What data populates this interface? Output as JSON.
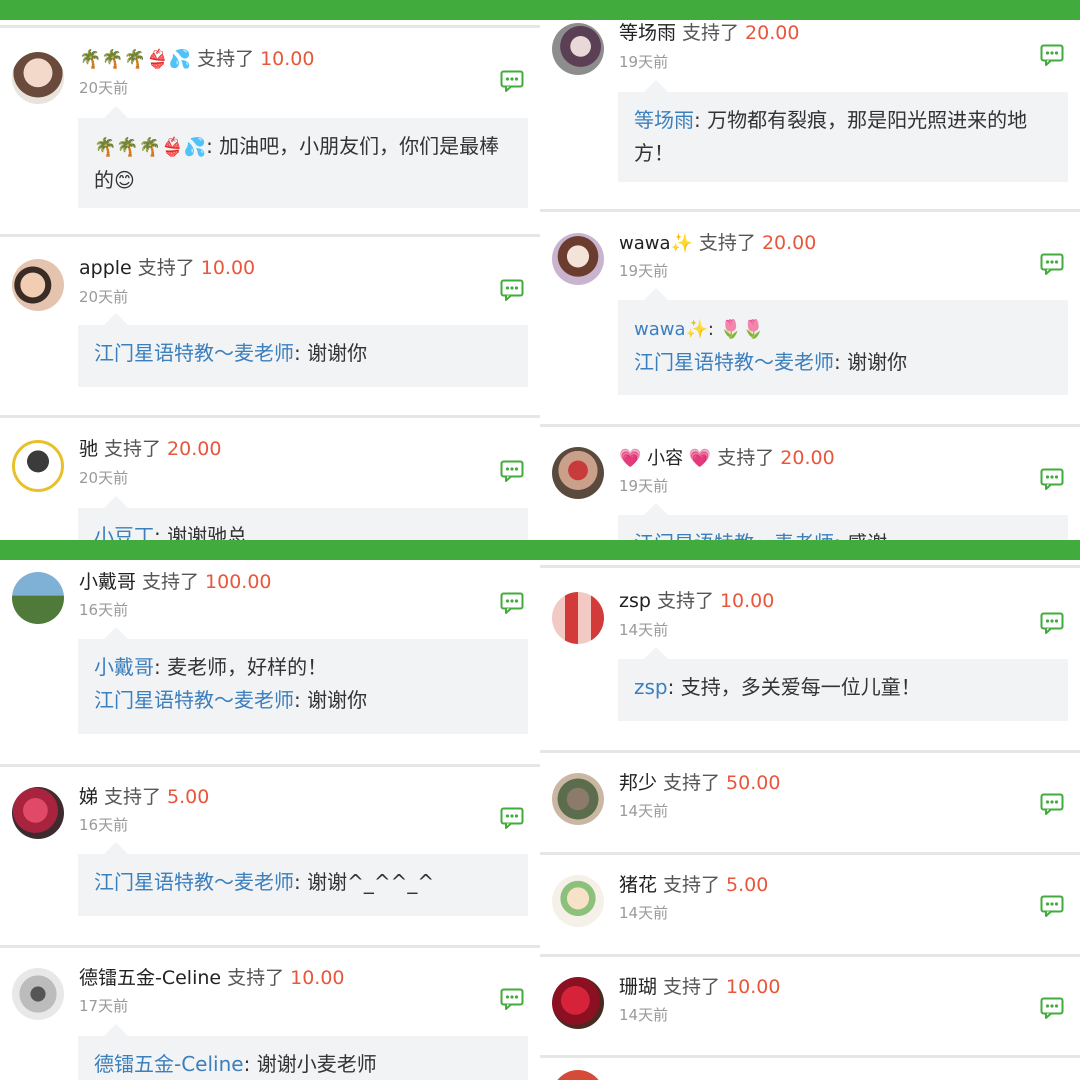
{
  "colors": {
    "accent_green": "#42ab3e",
    "amount_red": "#e8573c",
    "name_blue": "#3c7fbd"
  },
  "icons": {
    "comment": "comment-bubble-icon"
  },
  "tl": {
    "c1": {
      "user": "🌴🌴🌴👙💦",
      "supported": "支持了",
      "amount": "10.00",
      "time": "20天前",
      "msg_user": "🌴🌴🌴👙💦",
      "msg_text": ": 加油吧，小朋友们，你们是最棒的😊"
    },
    "c2": {
      "user": "apple",
      "supported": "支持了",
      "amount": "10.00",
      "time": "20天前",
      "reply_user": "江门星语特教～麦老师",
      "reply_text": ": 谢谢你"
    },
    "c3": {
      "user": "驰",
      "supported": "支持了",
      "amount": "20.00",
      "time": "20天前",
      "reply_user": "小豆丁",
      "reply_text": ": 谢谢驰总"
    }
  },
  "tr": {
    "c1": {
      "user": "等场雨",
      "supported": "支持了",
      "amount": "20.00",
      "time": "19天前",
      "msg_user": "等场雨",
      "msg_text": ": 万物都有裂痕，那是阳光照进来的地方！"
    },
    "c2": {
      "user": "wawa✨",
      "supported": "支持了",
      "amount": "20.00",
      "time": "19天前",
      "msg_user": "wawa✨",
      "msg_text": ": 🌷🌷",
      "reply_user": "江门星语特教～麦老师",
      "reply_text": ": 谢谢你"
    },
    "c3": {
      "user": "💗 小容 💗",
      "supported": "支持了",
      "amount": "20.00",
      "time": "19天前",
      "reply_user": "江门星语特教～麦老师",
      "reply_text": ": 感谢"
    }
  },
  "bl": {
    "c1": {
      "user": "小戴哥",
      "supported": "支持了",
      "amount": "100.00",
      "time": "16天前",
      "msg_user": "小戴哥",
      "msg_text": ": 麦老师，好样的！",
      "reply_user": "江门星语特教～麦老师",
      "reply_text": ": 谢谢你"
    },
    "c2": {
      "user": "娣",
      "supported": "支持了",
      "amount": "5.00",
      "time": "16天前",
      "reply_user": "江门星语特教～麦老师",
      "reply_text": ": 谢谢^_^^_^"
    },
    "c3": {
      "user": "德镭五金-Celine",
      "supported": "支持了",
      "amount": "10.00",
      "time": "17天前",
      "msg_user": "德镭五金-Celine",
      "msg_text": ": 谢谢小麦老师"
    }
  },
  "br": {
    "c1": {
      "user": "zsp",
      "supported": "支持了",
      "amount": "10.00",
      "time": "14天前",
      "msg_user": "zsp",
      "msg_text": ": 支持，多关爱每一位儿童！"
    },
    "c2": {
      "user": "邦少",
      "supported": "支持了",
      "amount": "50.00",
      "time": "14天前"
    },
    "c3": {
      "user": "猪花",
      "supported": "支持了",
      "amount": "5.00",
      "time": "14天前"
    },
    "c4": {
      "user": "珊瑚",
      "supported": "支持了",
      "amount": "10.00",
      "time": "14天前"
    }
  }
}
